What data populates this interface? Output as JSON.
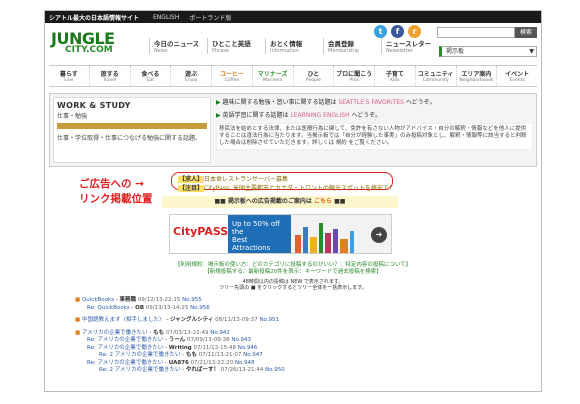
{
  "topbar": {
    "site": "シアトル最大の日本語情報サイト",
    "links": [
      "ENGLISH",
      "ポートランド版"
    ]
  },
  "logo": {
    "main": "JUNGLE",
    "sub": "CITY.COM"
  },
  "topnav": [
    {
      "jp": "今日のニュース",
      "en": "News"
    },
    {
      "jp": "ひとこと英語",
      "en": "Phrase"
    },
    {
      "jp": "おとく情報",
      "en": "Information"
    },
    {
      "jp": "会員登録",
      "en": "Membership"
    },
    {
      "jp": "ニュースレター",
      "en": "Newsletter"
    }
  ],
  "social": {
    "twitter": "t",
    "facebook": "f",
    "rss": "r"
  },
  "search": {
    "placeholder": "",
    "button": "検索"
  },
  "bbs_select": "掲示板",
  "categories": [
    {
      "jp": "暮らす",
      "en": "Live"
    },
    {
      "jp": "旅する",
      "en": "Travel"
    },
    {
      "jp": "食べる",
      "en": "Eat"
    },
    {
      "jp": "遊ぶ",
      "en": "Enjoy"
    },
    {
      "jp": "コーヒー",
      "en": "Coffee"
    },
    {
      "jp": "マリナーズ",
      "en": "Mariners"
    },
    {
      "jp": "ひと",
      "en": "People"
    },
    {
      "jp": "プロに聞こう",
      "en": "Pros"
    },
    {
      "jp": "子育て",
      "en": "Kids"
    },
    {
      "jp": "コミュニティ",
      "en": "Community"
    },
    {
      "jp": "エリア案内",
      "en": "Neighborhoods"
    },
    {
      "jp": "イベント",
      "en": "Events"
    }
  ],
  "work": {
    "title": "WORK & STUDY",
    "sub": "仕事・勉強",
    "desc": "仕事・学位取得・仕事につなげる勉強に関する話題。",
    "row1": "趣味に関する勉強・習い事に関する話題は ",
    "row1_link": "SEATTLE'S FAVORITES",
    "row1_end": " へどうぞ。",
    "row2": "英語学習に関する話題は ",
    "row2_link": "LEARNING ENGLISH",
    "row2_end": " へどうぞ。",
    "notice": "移民法を始めとする法律、または医療行為に関して、免許を有さない人物がアドバイス・自分の解釈・情報などを他人に提供することは違法行為に当たります。当掲示板では「自分が経験した事実」のみ投稿対象とし、解釈・情報等に該当すると判断した場合は削除させていただきます。詳しくは 規約 をご覧ください。"
  },
  "promo": {
    "line1": "ご広告への →",
    "line2": "リンク掲載位置"
  },
  "ad": {
    "tag1": "【求人】",
    "line1": "日本食レストランサーバー募集",
    "tag2": "【注目】",
    "line2": "CityPass: 米国主要都市とカナダ・トロントの観光スポットを格安で！"
  },
  "adbanner": {
    "pre": "■■ 掲示板への広告掲載のご案内は ",
    "here": "こちら",
    "post": " ■■"
  },
  "citypass": {
    "logo": "CityPASS",
    "offer_top": "Up to 50% off the",
    "offer_bottom": "Best Attractions",
    "go": "➜"
  },
  "info": {
    "line1": "【利用規約：掲示板の使い方：どのカテゴリに投稿するのがいい？：特定内容の投稿について】",
    "line2": "【新規投稿する：最新投稿20件を表示：キーワードで過去投稿を検索】"
  },
  "small": {
    "line1": "48時間以内の投稿は NEW で表示されます。",
    "line2": "ツリー先頭の ■ をクリックするとツリー全体を一括表示します。"
  },
  "threads": [
    {
      "indent": 0,
      "sq": "■",
      "title": "QuickBooks",
      "by": "事務職",
      "date": "09/12/13-22:15",
      "no": "No.955"
    },
    {
      "indent": 1,
      "sq": "",
      "title": "Re: QuickBooks",
      "by": "OB",
      "date": "09/13/13-14:25",
      "no": "No.956"
    },
    {
      "indent": 0,
      "sq": "■",
      "title": "中国語教えます（相手しました）",
      "by": "ジャングルシティ",
      "date": "08/11/13-09:37",
      "no": "No.951"
    },
    {
      "indent": 0,
      "sq": "■",
      "title": "アメリカの企業で働きたい",
      "by": "もも",
      "date": "07/03/13-22:49",
      "no": "No.942"
    },
    {
      "indent": 1,
      "sq": "",
      "title": "Re: アメリカの企業で働きたい",
      "by": "うーん",
      "date": "07/09/13-09:38",
      "no": "No.943"
    },
    {
      "indent": 1,
      "sq": "",
      "title": "Re: アメリカの企業で働きたい",
      "by": "Writing",
      "date": "07/11/13-15:48",
      "no": "No.946"
    },
    {
      "indent": 2,
      "sq": "",
      "title": "Re: 2 アメリカの企業で働きたい",
      "by": "もも",
      "date": "07/11/13-21:07",
      "no": "No.947"
    },
    {
      "indent": 1,
      "sq": "",
      "title": "Re: アメリカの企業で働きたい",
      "by": "UA876",
      "date": "07/21/13-22:20",
      "no": "No.948"
    },
    {
      "indent": 2,
      "sq": "",
      "title": "Re: 2 アメリカの企業で働きたい",
      "by": "やればーす！",
      "date": "07/26/13-21:44",
      "no": "No.950"
    }
  ],
  "colors": {
    "brand_green": "#2a8a2a",
    "promo_red": "#e02020",
    "coffee_orange": "#e08020",
    "citypass_blue": "#1e6fb8"
  }
}
